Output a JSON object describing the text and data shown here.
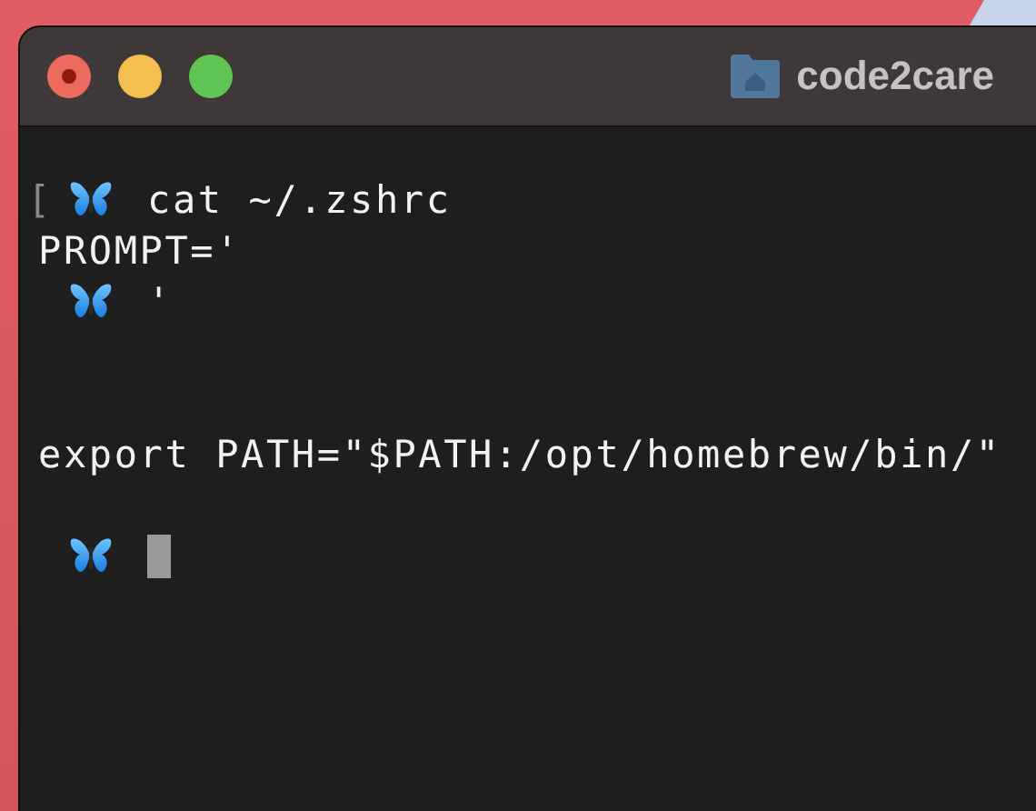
{
  "window": {
    "title": "code2care"
  },
  "terminal": {
    "lines": [
      {
        "kind": "prompt",
        "mark": "[",
        "text": "cat ~/.zshrc"
      },
      {
        "kind": "output",
        "text": "PROMPT='"
      },
      {
        "kind": "prompt",
        "text": "'"
      },
      {
        "kind": "blank"
      },
      {
        "kind": "blank"
      },
      {
        "kind": "output",
        "text": "export PATH=\"$PATH:/opt/homebrew/bin/\""
      },
      {
        "kind": "blank"
      },
      {
        "kind": "prompt",
        "cursor": true
      }
    ]
  }
}
